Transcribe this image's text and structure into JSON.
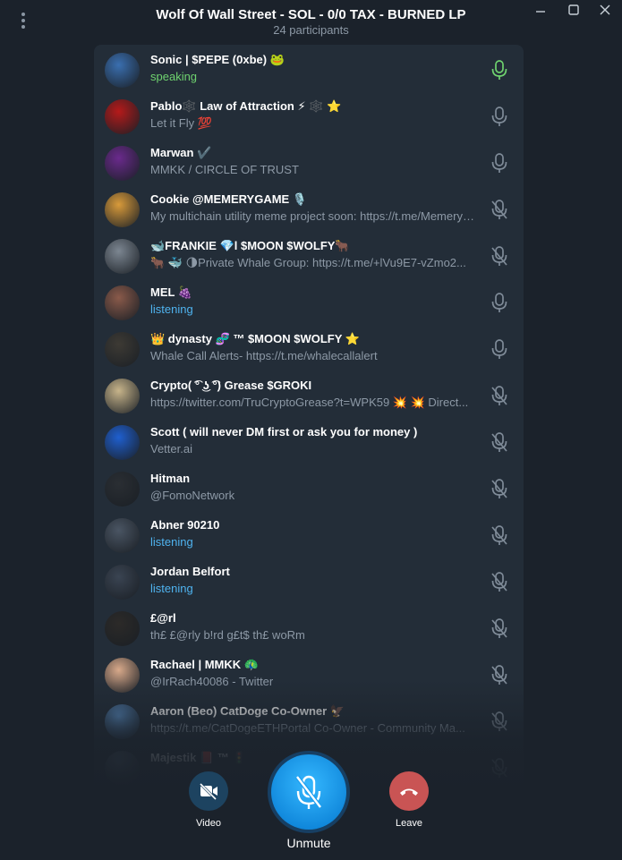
{
  "window": {
    "title": "Wolf Of Wall Street - SOL - 0/0 TAX - BURNED LP",
    "subtitle": "24 participants"
  },
  "participants": [
    {
      "name": "Sonic | $PEPE (0xbe) 🐸",
      "status": "speaking",
      "status_type": "speaking",
      "mic": "active",
      "avatar_color": "#3a6fb0"
    },
    {
      "name": "Pablo🕸️ Law of Attraction ⚡ 🕸️ ⭐",
      "status": "Let it Fly 💯",
      "status_type": "bio",
      "mic": "on",
      "avatar_color": "#b51a1a"
    },
    {
      "name": "Marwan ✔️",
      "status": "MMKK / CIRCLE OF TRUST",
      "status_type": "bio",
      "mic": "on",
      "avatar_color": "#6a2a8c"
    },
    {
      "name": "Cookie @MEMERYGAME 🎙️",
      "status": "My multichain utility meme project soon: https://t.me/MemeryGame",
      "status_type": "bio",
      "mic": "muted",
      "avatar_color": "#d89a3a"
    },
    {
      "name": "🐋FRANKIE 💎l $MOON $WOLFY🐂",
      "status": "🐂 🐳 🌗Private Whale Group: https://t.me/+lVu9E7-vZmo2...",
      "status_type": "bio",
      "mic": "muted",
      "avatar_color": "#7c8691"
    },
    {
      "name": "MEL 🍇",
      "status": "listening",
      "status_type": "listening",
      "mic": "on",
      "avatar_color": "#8a5a4a"
    },
    {
      "name": "👑 dynasty 🧬 ™ $MOON $WOLFY ⭐",
      "status": "Whale Call Alerts- https://t.me/whalecallalert",
      "status_type": "bio",
      "mic": "on",
      "avatar_color": "#3d3a34"
    },
    {
      "name": "Crypto( ͡° ͜ʖ ͡°) Grease $GROKI",
      "status": "https://twitter.com/TruCryptoGrease?t=WPK59 💥 💥 Direct...",
      "status_type": "bio",
      "mic": "muted",
      "avatar_color": "#c7b48a"
    },
    {
      "name": "Scott ( will never DM first or ask you for money )",
      "status": "Vetter.ai",
      "status_type": "bio",
      "mic": "muted",
      "avatar_color": "#1f5fcf"
    },
    {
      "name": "Hitman",
      "status": "@FomoNetwork",
      "status_type": "bio",
      "mic": "muted",
      "avatar_color": "#2a2e33"
    },
    {
      "name": "Abner 90210",
      "status": "listening",
      "status_type": "listening",
      "mic": "muted",
      "avatar_color": "#4a5563"
    },
    {
      "name": "Jordan Belfort",
      "status": "listening",
      "status_type": "listening",
      "mic": "muted",
      "avatar_color": "#3a4452"
    },
    {
      "name": "£@rl",
      "status": "th£ £@rly b!rd g£t$ th£ woRm",
      "status_type": "bio",
      "mic": "muted",
      "avatar_color": "#2c2a28"
    },
    {
      "name": "Rachael | MMKK 🦚",
      "status": "@IrRach40086 - Twitter",
      "status_type": "bio",
      "mic": "muted",
      "avatar_color": "#d8a98a"
    },
    {
      "name": "Aaron (Beo) CatDoge Co-Owner 🦅",
      "status": "https://t.me/CatDogeETHPortal Co-Owner - Community Ma...",
      "status_type": "bio",
      "mic": "muted",
      "avatar_color": "#5a8fc7"
    },
    {
      "name": "Majestik 📕 ™ 🚦",
      "status": "",
      "status_type": "bio",
      "mic": "muted",
      "avatar_color": "#5a6a7a"
    }
  ],
  "controls": {
    "video_label": "Video",
    "unmute_label": "Unmute",
    "leave_label": "Leave"
  },
  "colors": {
    "background": "#1b222b",
    "panel": "#232d38",
    "speaking": "#6fd36f",
    "listening": "#4fb3ef",
    "unmute": "#1e9ff0",
    "leave": "#c95454",
    "video": "#1d4360"
  },
  "icons": {
    "menu": "vertical-dots-icon",
    "minimize": "minimize-icon",
    "maximize": "maximize-icon",
    "close": "close-icon",
    "mic_on": "microphone-icon",
    "mic_muted": "microphone-muted-icon",
    "video": "video-off-icon",
    "leave": "phone-hangup-icon"
  }
}
